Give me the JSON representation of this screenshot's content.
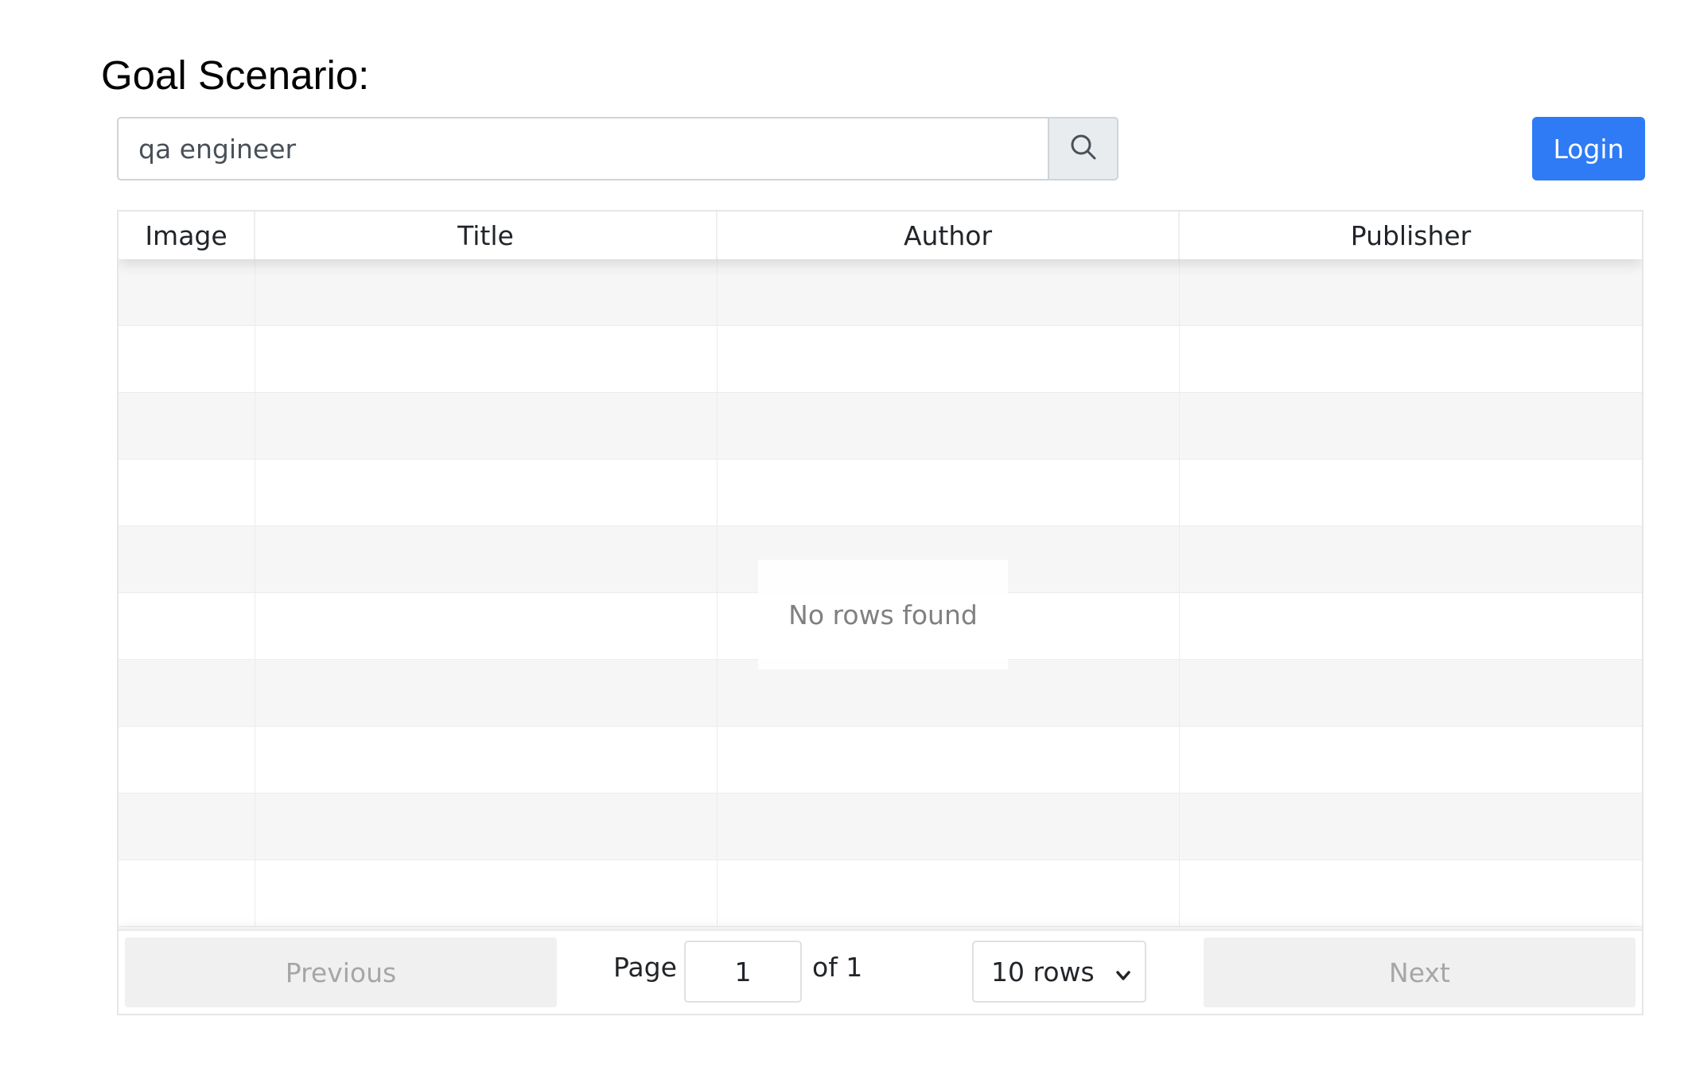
{
  "header": {
    "title": "Goal Scenario:"
  },
  "search": {
    "value": "qa engineer",
    "button_icon": "search-icon"
  },
  "login": {
    "label": "Login",
    "color": "#2f7bf5"
  },
  "table": {
    "columns": [
      "Image",
      "Title",
      "Author",
      "Publisher"
    ],
    "rows": [],
    "empty_message": "No rows found"
  },
  "pagination": {
    "previous_label": "Previous",
    "page_label": "Page",
    "current_page": "1",
    "of_label": "of 1",
    "rows_option": "10 rows",
    "next_label": "Next"
  }
}
